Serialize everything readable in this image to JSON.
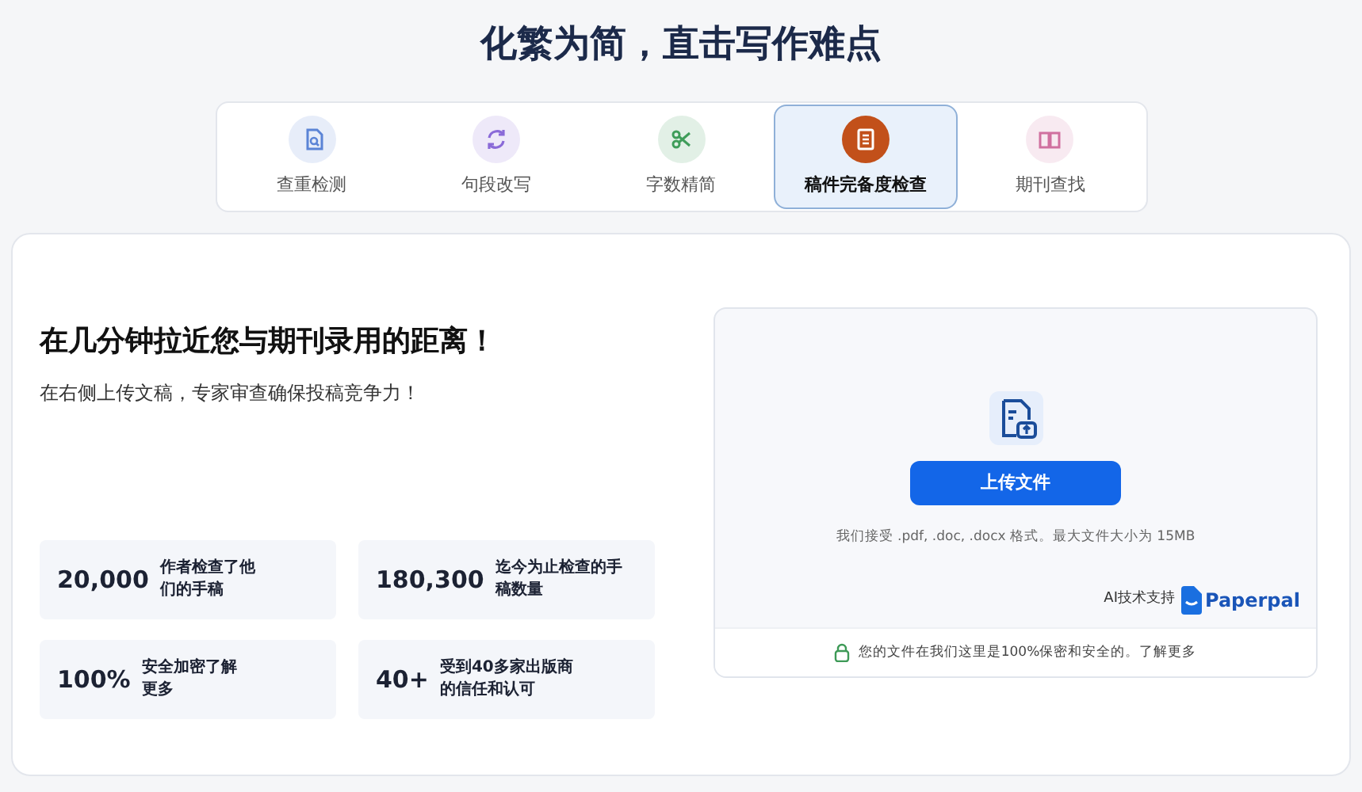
{
  "heading": "化繁为简，直击写作难点",
  "tabs": [
    {
      "label": "查重检测",
      "selected": false,
      "color": "#5b84d6"
    },
    {
      "label": "句段改写",
      "selected": false,
      "color": "#8a6ad8"
    },
    {
      "label": "字数精简",
      "selected": false,
      "color": "#3f9d5a"
    },
    {
      "label": "稿件完备度检查",
      "selected": true,
      "color": "#c2501a"
    },
    {
      "label": "期刊查找",
      "selected": false,
      "color": "#d0709f"
    }
  ],
  "intro": {
    "title": "在几分钟拉近您与期刊录用的距离！",
    "subtitle": "在右侧上传文稿，专家审查确保投稿竞争力！"
  },
  "stats": [
    {
      "value": "20,000",
      "label": "作者检查了他们的手稿"
    },
    {
      "value": "180,300",
      "label": "迄今为止检查的手稿数量"
    },
    {
      "value": "100%",
      "label": "安全加密了解更多"
    },
    {
      "value": "40+",
      "label": "受到40多家出版商的信任和认可"
    }
  ],
  "upload": {
    "button": "上传文件",
    "formats": "我们接受 .pdf, .doc, .docx 格式。最大文件大小为 15MB",
    "powered_by": "AI技术支持",
    "brand": "Paperpal",
    "security_note": "您的文件在我们这里是100%保密和安全的。了解更多"
  }
}
